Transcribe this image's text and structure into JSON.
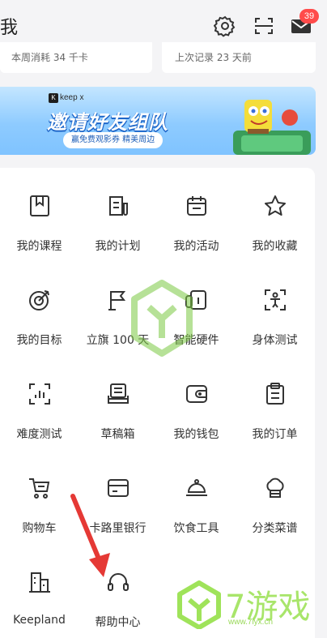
{
  "header": {
    "title": "我",
    "badge_count": "39"
  },
  "stats": {
    "left_text": "本周消耗 34 千卡",
    "right_text": "上次记录 23 天前"
  },
  "banner": {
    "brand": "keep x",
    "brand_k": "K",
    "title": "邀请好友组队",
    "subtitle": "赢免费观影券 精美周边"
  },
  "grid": {
    "items": [
      {
        "label": "我的课程",
        "icon": "bookmark-icon"
      },
      {
        "label": "我的计划",
        "icon": "plan-icon"
      },
      {
        "label": "我的活动",
        "icon": "calendar-icon"
      },
      {
        "label": "我的收藏",
        "icon": "star-icon"
      },
      {
        "label": "我的目标",
        "icon": "target-icon"
      },
      {
        "label": "立旗 100 天",
        "icon": "flag-icon"
      },
      {
        "label": "智能硬件",
        "icon": "device-icon"
      },
      {
        "label": "身体测试",
        "icon": "body-scan-icon"
      },
      {
        "label": "难度测试",
        "icon": "difficulty-icon"
      },
      {
        "label": "草稿箱",
        "icon": "drafts-icon"
      },
      {
        "label": "我的钱包",
        "icon": "wallet-icon"
      },
      {
        "label": "我的订单",
        "icon": "orders-icon"
      },
      {
        "label": "购物车",
        "icon": "cart-icon"
      },
      {
        "label": "卡路里银行",
        "icon": "card-icon"
      },
      {
        "label": "饮食工具",
        "icon": "cloche-icon"
      },
      {
        "label": "分类菜谱",
        "icon": "chef-hat-icon"
      },
      {
        "label": "Keepland",
        "icon": "building-icon"
      },
      {
        "label": "帮助中心",
        "icon": "headset-icon"
      }
    ]
  },
  "watermark": {
    "text": "7游戏",
    "url": "www.7lyx.cn"
  },
  "colors": {
    "accent": "#ff4b4b",
    "banner": "#8ecbff",
    "icon_stroke": "#333333"
  }
}
